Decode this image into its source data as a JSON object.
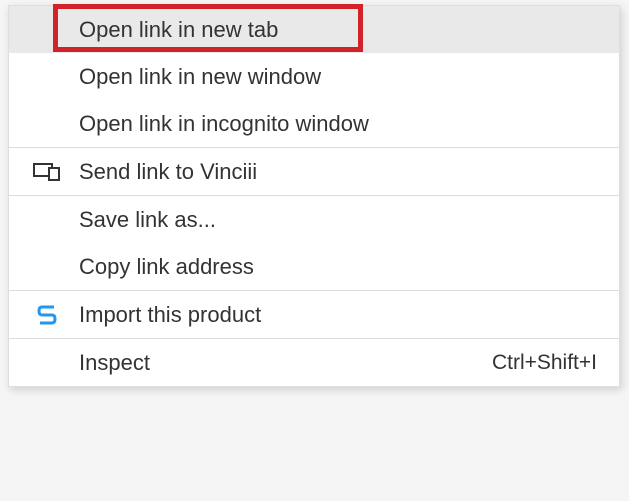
{
  "context_menu": {
    "groups": [
      {
        "items": [
          {
            "id": "open-new-tab",
            "label": "Open link in new tab",
            "highlighted": true
          },
          {
            "id": "open-new-window",
            "label": "Open link in new window",
            "highlighted": false
          },
          {
            "id": "open-incognito",
            "label": "Open link in incognito window",
            "highlighted": false
          }
        ]
      },
      {
        "items": [
          {
            "id": "send-link",
            "label": "Send link to Vinciii",
            "icon": "devices-icon"
          }
        ]
      },
      {
        "items": [
          {
            "id": "save-link-as",
            "label": "Save link as..."
          },
          {
            "id": "copy-link",
            "label": "Copy link address"
          }
        ]
      },
      {
        "items": [
          {
            "id": "import-product",
            "label": "Import this product",
            "icon": "s-icon",
            "icon_color": "#2196F3"
          }
        ]
      },
      {
        "items": [
          {
            "id": "inspect",
            "label": "Inspect",
            "shortcut": "Ctrl+Shift+I"
          }
        ]
      }
    ]
  }
}
